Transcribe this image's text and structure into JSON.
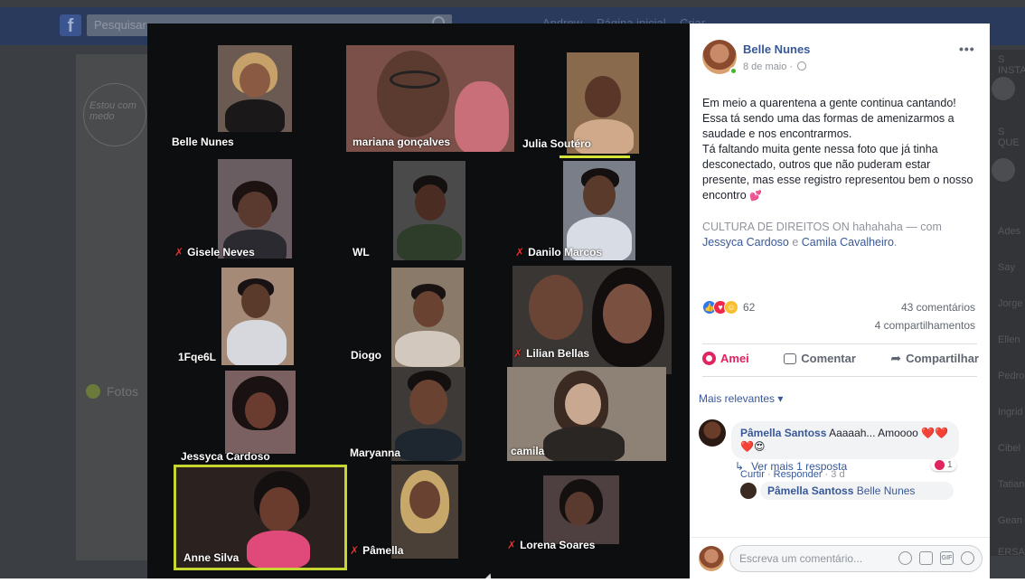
{
  "background": {
    "search_placeholder": "Pesquisar",
    "nav": [
      "Andrew",
      "Página inicial",
      "Criar"
    ],
    "left_card_text": "Estou com medo",
    "fotos_label": "Fotos",
    "right_names": [
      "Ades",
      "Say",
      "Jorge",
      "Ellen",
      "Pedro",
      "Ingrid",
      "Cibel",
      "Tatian",
      "Gean"
    ],
    "right_headers": [
      "S INSTA",
      "S QUE",
      "ERSAS"
    ]
  },
  "photo": {
    "participants": [
      {
        "name": "Belle Nunes",
        "muted": false
      },
      {
        "name": "mariana gonçalves",
        "muted": false
      },
      {
        "name": "Julia Soutéro",
        "muted": false
      },
      {
        "name": "Gisele Neves",
        "muted": true
      },
      {
        "name": "WL",
        "muted": false
      },
      {
        "name": "Danilo Marcos",
        "muted": true
      },
      {
        "name": "1Fqe6L",
        "muted": false
      },
      {
        "name": "Diogo",
        "muted": false
      },
      {
        "name": "Lilian Bellas",
        "muted": true
      },
      {
        "name": "Jessyca Cardoso",
        "muted": false
      },
      {
        "name": "Maryanna",
        "muted": false
      },
      {
        "name": "camila",
        "muted": false
      },
      {
        "name": "Anne Silva",
        "muted": false
      },
      {
        "name": "Pâmella",
        "muted": true
      },
      {
        "name": "Lorena Soares",
        "muted": true
      }
    ],
    "mute_glyph": "✗"
  },
  "post": {
    "author": "Belle Nunes",
    "date": "8 de maio · ",
    "more": "•••",
    "body": "Em meio a quarentena a gente continua cantando! Essa tá sendo uma das formas de amenizarmos a saudade e nos encontrarmos.\nTá faltando muita gente nessa foto que já tinha desconectado, outros que não puderam estar presente, mas esse registro representou bem o nosso encontro ",
    "heart_emoji": "💕",
    "tagline_prefix": "CULTURA DE DIREITOS ON hahahaha — com",
    "tag1": "Jessyca Cardoso",
    "tag_join": " e ",
    "tag2": "Camila Cavalheiro",
    "tag_end": ".",
    "reaction_count": "62",
    "comments_count": "43 comentários",
    "shares_count": "4 compartilhamentos",
    "actions": {
      "love": "Amei",
      "comment": "Comentar",
      "share": "Compartilhar"
    },
    "sort_label": "Mais relevantes ▾",
    "comment": {
      "author": "Pâmella Santoss",
      "text": " Aaaaah... Amoooo ❤️❤️❤️😍",
      "reaction_count": "1",
      "like": "Curtir",
      "sep": " · ",
      "reply": "Responder",
      "time": " · 3 d"
    },
    "view_more": "Ver mais 1 resposta",
    "reply": {
      "author": "Pâmella Santoss",
      "text": " Belle Nunes"
    },
    "write_placeholder": "Escreva um comentário...",
    "write_icons": [
      "emoji-icon",
      "camera-icon",
      "gif-icon",
      "sticker-icon"
    ]
  },
  "colors": {
    "fb_blue": "#385898",
    "love_red": "#e0245e",
    "speaker_yellow": "#c6d630"
  }
}
